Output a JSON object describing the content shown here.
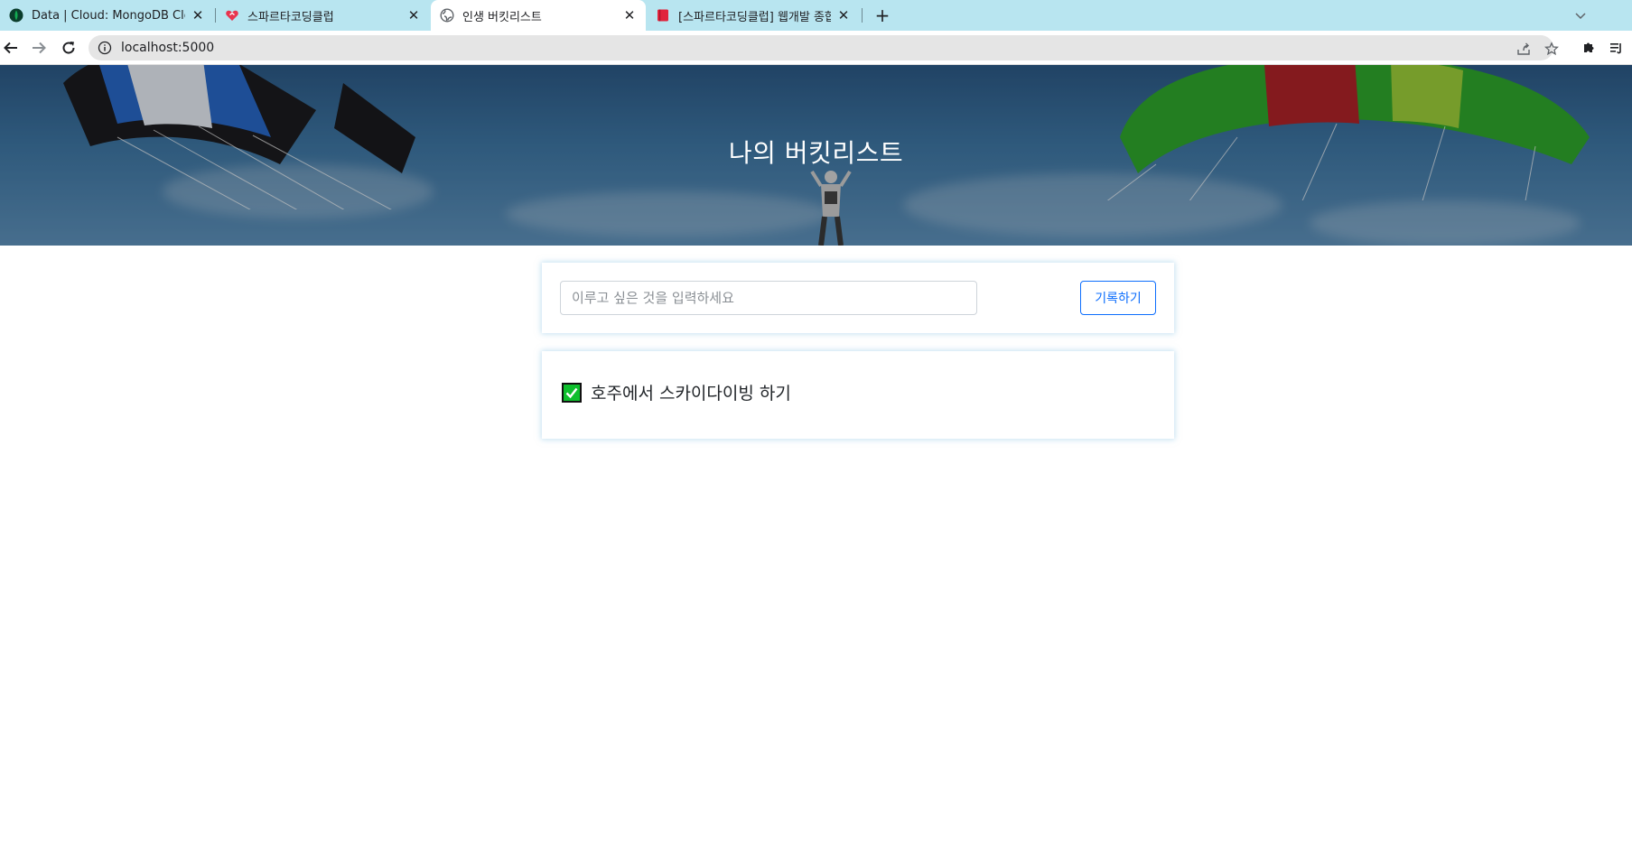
{
  "browser": {
    "tabs": [
      {
        "title": "Data | Cloud: MongoDB Cloud",
        "favicon": "mongodb-leaf-icon",
        "active": false
      },
      {
        "title": "스파르타코딩클럽",
        "favicon": "sparta-heart-icon",
        "active": false
      },
      {
        "title": "인생 버킷리스트",
        "favicon": "globe-icon",
        "active": true
      },
      {
        "title": "[스파르타코딩클럽] 웹개발 종합반",
        "favicon": "book-icon",
        "active": false
      }
    ],
    "url": "localhost:5000"
  },
  "page": {
    "title": "나의 버킷리스트",
    "input_placeholder": "이루고 싶은 것을 입력하세요",
    "save_label": "기록하기",
    "items": [
      {
        "text": "호주에서 스카이다이빙 하기",
        "done": true
      }
    ]
  },
  "colors": {
    "tabstrip": "#b8e5f0",
    "accent": "#0d6efd",
    "check": "#0ebf2d"
  }
}
